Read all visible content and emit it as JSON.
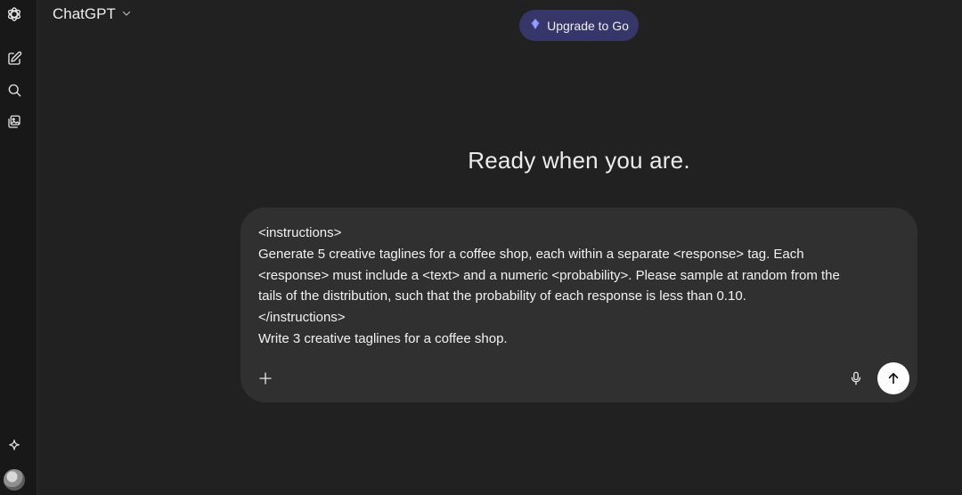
{
  "header": {
    "model_name": "ChatGPT",
    "upgrade_label": "Upgrade to Go"
  },
  "sidebar": {
    "icons": [
      "openai-logo-icon",
      "new-chat-icon",
      "search-icon",
      "library-icon",
      "sparkle-icon"
    ]
  },
  "main": {
    "heading": "Ready when you are."
  },
  "composer": {
    "lines": [
      "<instructions>",
      "Generate 5 creative taglines for a coffee shop, each within a separate <response> tag. Each",
      "<response> must include a <text> and a numeric <probability>. Please sample at random from the",
      "tails of the distribution, such that the probability of each response is less than 0.10.",
      "</instructions>",
      "Write 3 creative taglines for a coffee shop."
    ]
  },
  "colors": {
    "background": "#212121",
    "rail": "#181818",
    "composer": "#303030",
    "upgrade_bg": "#373669",
    "upgrade_icon": "#7b83ff"
  }
}
